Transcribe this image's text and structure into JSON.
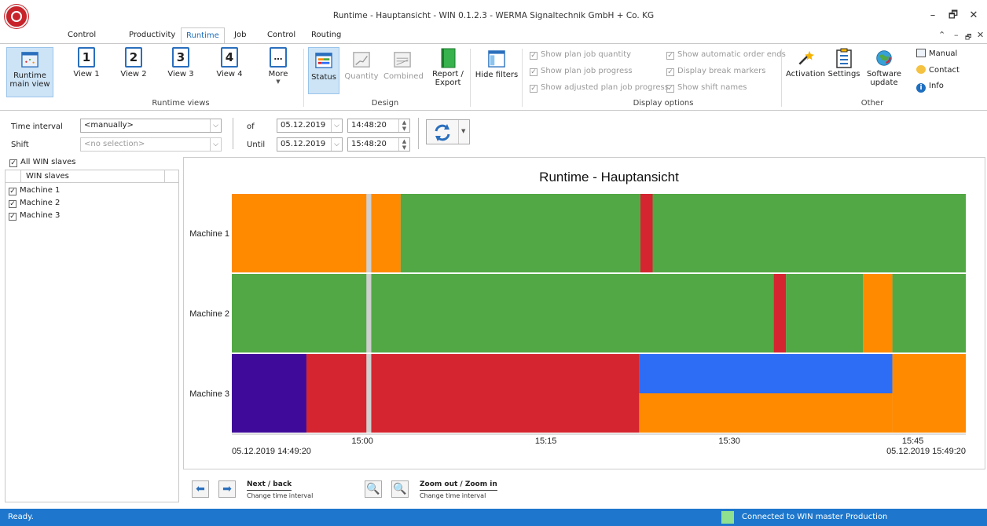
{
  "window": {
    "title": "Runtime - Hauptansicht - WIN 0.1.2.3 - WERMA Signaltechnik GmbH + Co. KG",
    "controls": [
      "–",
      "🗗",
      "✕"
    ]
  },
  "tabs": [
    "Control station",
    "Productivity",
    "Runtime",
    "Job",
    "Control",
    "Routing"
  ],
  "active_tab": "Runtime",
  "ribbon": {
    "main_view": "Runtime main view",
    "runtime_views": {
      "group": "Runtime views",
      "buttons": [
        {
          "num": "1",
          "label": "View 1"
        },
        {
          "num": "2",
          "label": "View 2"
        },
        {
          "num": "3",
          "label": "View 3"
        },
        {
          "num": "4",
          "label": "View 4"
        },
        {
          "num": "…",
          "label": "More"
        }
      ]
    },
    "design": {
      "group": "Design",
      "buttons": [
        "Status",
        "Quantity",
        "Combined",
        "Report / Export",
        "Hide filters"
      ]
    },
    "display_options": {
      "group": "Display options",
      "options": [
        "Show plan job quantity",
        "Show plan job progress",
        "Show adjusted plan job progress",
        "Show automatic order ends",
        "Display break markers",
        "Show shift names"
      ]
    },
    "other": {
      "group": "Other",
      "buttons": [
        "Activation",
        "Settings",
        "Software update"
      ],
      "links": [
        "Manual",
        "Contact",
        "Info"
      ]
    }
  },
  "filters": {
    "time_interval_label": "Time interval",
    "time_interval_value": "<manually>",
    "shift_label": "Shift",
    "shift_value": "<no selection>",
    "of_label": "of",
    "until_label": "Until",
    "from_date": "05.12.2019",
    "from_time": "14:48:20",
    "until_date": "05.12.2019",
    "until_time": "15:48:20"
  },
  "slaves": {
    "all_label": "All WIN slaves",
    "column": "WIN slaves",
    "items": [
      "Machine 1",
      "Machine 2",
      "Machine 3"
    ]
  },
  "chart_data": {
    "type": "timeline",
    "title": "Runtime - Hauptansicht",
    "x_start": "05.12.2019 14:49:20",
    "x_end": "05.12.2019 15:49:20",
    "ticks": [
      "15:00",
      "15:15",
      "15:30",
      "15:45"
    ],
    "tick_minutes": [
      10.67,
      25.67,
      40.67,
      55.67
    ],
    "total_minutes": 60,
    "gap_at_minutes": 11.25,
    "colors": {
      "orange": "#ff8a00",
      "green": "#52a844",
      "red": "#d52530",
      "purple": "#3f0a9a",
      "blue": "#2d6cf5"
    },
    "rows": [
      {
        "name": "Machine 1",
        "segments": [
          {
            "start": 0,
            "end": 11.0,
            "color": "orange"
          },
          {
            "start": 11.4,
            "end": 13.8,
            "color": "orange"
          },
          {
            "start": 13.8,
            "end": 33.4,
            "color": "green"
          },
          {
            "start": 33.4,
            "end": 34.4,
            "color": "red"
          },
          {
            "start": 34.4,
            "end": 60,
            "color": "green"
          }
        ]
      },
      {
        "name": "Machine 2",
        "segments": [
          {
            "start": 0,
            "end": 11.0,
            "color": "green"
          },
          {
            "start": 11.4,
            "end": 44.3,
            "color": "green"
          },
          {
            "start": 44.3,
            "end": 45.3,
            "color": "red"
          },
          {
            "start": 45.3,
            "end": 51.6,
            "color": "green"
          },
          {
            "start": 51.6,
            "end": 54.0,
            "color": "orange"
          },
          {
            "start": 54.0,
            "end": 60,
            "color": "green"
          }
        ]
      },
      {
        "name": "Machine 3",
        "segments": [
          {
            "start": 0,
            "end": 6.1,
            "color": "purple"
          },
          {
            "start": 6.1,
            "end": 11.0,
            "color": "red"
          },
          {
            "start": 11.4,
            "end": 33.3,
            "color": "red"
          },
          {
            "start": 33.3,
            "end": 54.0,
            "color": "blue",
            "part": "top"
          },
          {
            "start": 33.3,
            "end": 54.0,
            "color": "orange",
            "part": "bottom"
          },
          {
            "start": 54.0,
            "end": 60,
            "color": "orange"
          }
        ]
      }
    ]
  },
  "nav": {
    "next_back": "Next / back",
    "next_back_sub": "Change time interval",
    "zoom": "Zoom out / Zoom in",
    "zoom_sub": "Change time interval"
  },
  "status": {
    "left": "Ready.",
    "right": "Connected to WIN master Production",
    "indicator_color": "#8fe08f"
  }
}
